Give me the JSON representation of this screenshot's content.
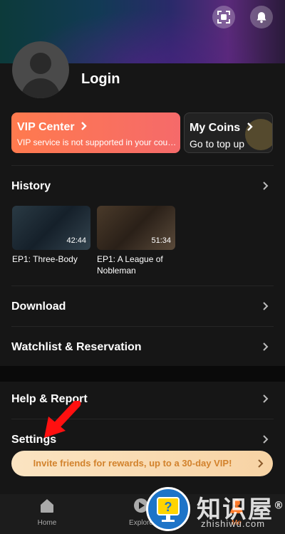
{
  "profile": {
    "login_label": "Login"
  },
  "vip": {
    "title": "VIP Center",
    "subtitle": "VIP service is not supported in your country"
  },
  "coins": {
    "title": "My Coins",
    "subtitle": "Go to top up"
  },
  "history": {
    "title": "History",
    "items": [
      {
        "duration": "42:44",
        "title": "EP1: Three-Body"
      },
      {
        "duration": "51:34",
        "title": "EP1: A League of Nobleman"
      }
    ]
  },
  "menu": {
    "download": "Download",
    "watchlist": "Watchlist & Reservation",
    "help": "Help & Report",
    "settings": "Settings"
  },
  "invite": {
    "text": "Invite friends for rewards, up to a 30-day VIP!"
  },
  "nav": {
    "home": "Home",
    "explore": "Explore",
    "me": "Me"
  },
  "watermark": {
    "site": "知识屋",
    "url": "zhishiwu.com",
    "registered": "®"
  },
  "colors": {
    "vip_gradient_start": "#ff7a4e",
    "invite_text": "#d2822c",
    "arrow": "#ff1010"
  }
}
